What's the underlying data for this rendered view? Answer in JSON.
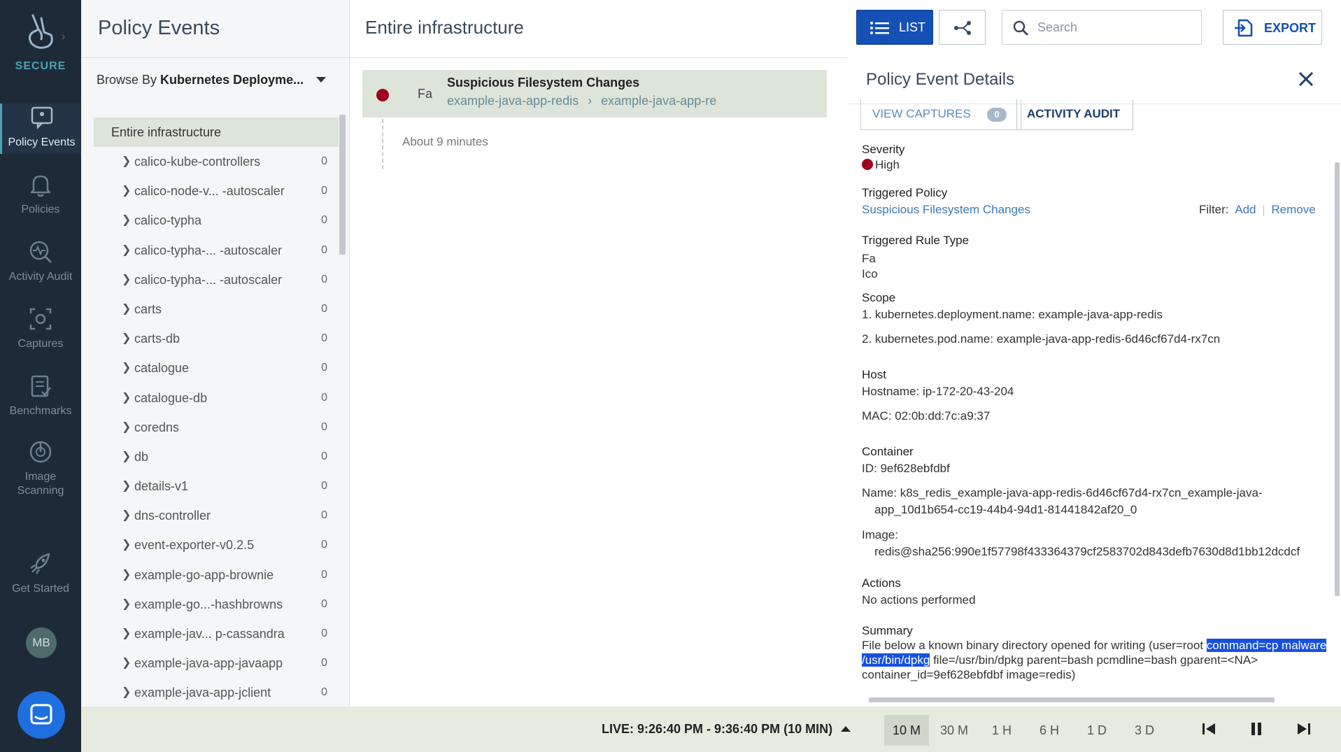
{
  "brand": {
    "label": "SECURE"
  },
  "nav": {
    "items": [
      {
        "label": "Policy Events",
        "icon": "policy-events-icon",
        "active": true
      },
      {
        "label": "Policies",
        "icon": "bell-icon",
        "active": false
      },
      {
        "label": "Activity Audit",
        "icon": "activity-audit-icon",
        "active": false
      },
      {
        "label": "Captures",
        "icon": "capture-icon",
        "active": false
      },
      {
        "label": "Benchmarks",
        "icon": "benchmarks-icon",
        "active": false
      },
      {
        "label": "Image Scanning",
        "icon": "image-scanning-icon",
        "active": false
      },
      {
        "label": "Get Started",
        "icon": "rocket-icon",
        "active": false
      }
    ],
    "avatar": "MB"
  },
  "events_panel": {
    "title": "Policy Events",
    "browse_prefix": "Browse By",
    "browse_value": "Kubernetes Deployme...",
    "root": "Entire infrastructure",
    "tree": [
      {
        "label": "calico-kube-controllers",
        "count": "0"
      },
      {
        "label": "calico-node-v... -autoscaler",
        "count": "0"
      },
      {
        "label": "calico-typha",
        "count": "0"
      },
      {
        "label": "calico-typha-... -autoscaler",
        "count": "0"
      },
      {
        "label": "calico-typha-... -autoscaler",
        "count": "0"
      },
      {
        "label": "carts",
        "count": "0"
      },
      {
        "label": "carts-db",
        "count": "0"
      },
      {
        "label": "catalogue",
        "count": "0"
      },
      {
        "label": "catalogue-db",
        "count": "0"
      },
      {
        "label": "coredns",
        "count": "0"
      },
      {
        "label": "db",
        "count": "0"
      },
      {
        "label": "details-v1",
        "count": "0"
      },
      {
        "label": "dns-controller",
        "count": "0"
      },
      {
        "label": "event-exporter-v0.2.5",
        "count": "0"
      },
      {
        "label": "example-go-app-brownie",
        "count": "0"
      },
      {
        "label": "example-go...-hashbrowns",
        "count": "0"
      },
      {
        "label": "example-jav... p-cassandra",
        "count": "0"
      },
      {
        "label": "example-java-app-javaapp",
        "count": "0"
      },
      {
        "label": "example-java-app-jclient",
        "count": "0"
      }
    ]
  },
  "list_panel": {
    "title": "Entire infrastructure",
    "event": {
      "type": "Fa",
      "name": "Suspicious Filesystem Changes",
      "crumb_1": "example-java-app-redis",
      "crumb_2": "example-java-app-re",
      "ago": "About 9 minutes",
      "severity_color": "#a0001a"
    }
  },
  "toolbar": {
    "list_label": "LIST",
    "search_placeholder": "Search",
    "export_label": "EXPORT",
    "accent": "#1550b4"
  },
  "details": {
    "title": "Policy Event Details",
    "view_captures_label": "VIEW CAPTURES",
    "captures_count": "0",
    "activity_audit_label": "ACTIVITY AUDIT",
    "severity_h": "Severity",
    "severity_v": "High",
    "policy_h": "Triggered Policy",
    "policy_v": "Suspicious Filesystem Changes",
    "filter_label": "Filter:",
    "filter_add": "Add",
    "filter_remove": "Remove",
    "rule_type_h": "Triggered Rule Type",
    "rule_type_1": "Fa",
    "rule_type_2": "Ico",
    "scope_h": "Scope",
    "scope_1": "1. kubernetes.deployment.name: example-java-app-redis",
    "scope_2": "2. kubernetes.pod.name: example-java-app-redis-6d46cf67d4-rx7cn",
    "host_h": "Host",
    "hostname": "Hostname: ip-172-20-43-204",
    "mac": "MAC: 02:0b:dd:7c:a9:37",
    "container_h": "Container",
    "container_id": "ID: 9ef628ebfdbf",
    "container_name_1": "Name: k8s_redis_example-java-app-redis-6d46cf67d4-rx7cn_example-java-",
    "container_name_2": "app_10d1b654-cc19-44b4-94d1-81441842af20_0",
    "image_h": "Image:",
    "image_v": "redis@sha256:990e1f57798f433364379cf2583702d843defb7630d8d1bb12dcdcf",
    "actions_h": "Actions",
    "actions_v": "No actions performed",
    "summary_h": "Summary",
    "summary_pre": "File below a known binary directory opened for writing (user=root ",
    "summary_hl": "command=cp malware /usr/bin/dpkg",
    "summary_post": " file=/usr/bin/dpkg parent=bash pcmdline=bash gparent=<NA> container_id=9ef628ebfdbf image=redis)"
  },
  "bottom": {
    "live": "LIVE: 9:26:40 PM - 9:36:40 PM (10 MIN)",
    "ranges": [
      "10 M",
      "30 M",
      "1 H",
      "6 H",
      "1 D",
      "3 D"
    ],
    "active_range": "10 M"
  }
}
